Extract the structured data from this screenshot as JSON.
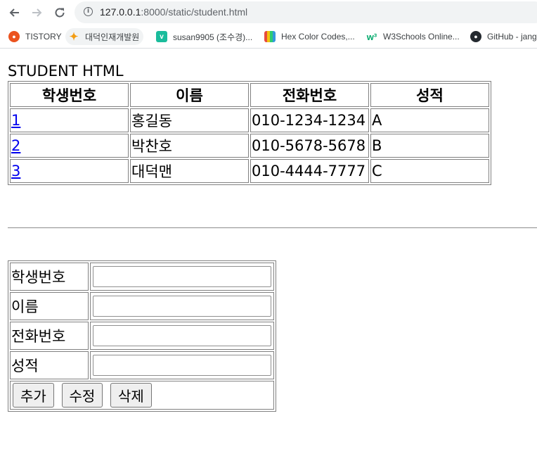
{
  "browser": {
    "url_host": "127.0.0.1",
    "url_rest": ":8000/static/student.html",
    "bookmarks": [
      {
        "label": "TISTORY",
        "icon": "tistory-icon"
      },
      {
        "label": "대덕인재개발원",
        "icon": "daedeok-icon"
      },
      {
        "label": "susan9905 (조수경)...",
        "icon": "velog-icon"
      },
      {
        "label": "Hex Color Codes,...",
        "icon": "hex-color-icon"
      },
      {
        "label": "W3Schools Online...",
        "icon": "w3schools-icon"
      },
      {
        "label": "GitHub - jang",
        "icon": "github-icon"
      }
    ]
  },
  "page": {
    "title": "STUDENT HTML",
    "table": {
      "headers": [
        "학생번호",
        "이름",
        "전화번호",
        "성적"
      ],
      "rows": [
        {
          "id": "1",
          "name": "홍길동",
          "phone": "010-1234-1234",
          "grade": "A"
        },
        {
          "id": "2",
          "name": "박찬호",
          "phone": "010-5678-5678",
          "grade": "B"
        },
        {
          "id": "3",
          "name": "대덕맨",
          "phone": "010-4444-7777",
          "grade": "C"
        }
      ]
    },
    "form": {
      "labels": {
        "id": "학생번호",
        "name": "이름",
        "phone": "전화번호",
        "grade": "성적"
      },
      "values": {
        "id": "",
        "name": "",
        "phone": "",
        "grade": ""
      },
      "buttons": {
        "add": "추가",
        "edit": "수정",
        "delete": "삭제"
      }
    }
  }
}
